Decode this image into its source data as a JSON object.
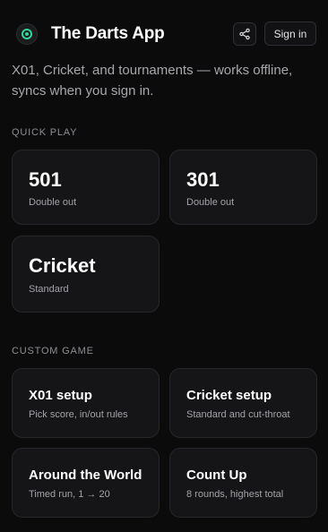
{
  "header": {
    "app_title": "The Darts App",
    "share_icon": "share-icon",
    "signin_label": "Sign in"
  },
  "tagline": "X01, Cricket, and tournaments — works offline, syncs when you sign in.",
  "quick_play": {
    "label": "QUICK PLAY",
    "cards": [
      {
        "title": "501",
        "subtitle": "Double out"
      },
      {
        "title": "301",
        "subtitle": "Double out"
      },
      {
        "title": "Cricket",
        "subtitle": "Standard"
      }
    ]
  },
  "custom_game": {
    "label": "CUSTOM GAME",
    "cards": [
      {
        "title": "X01 setup",
        "subtitle": "Pick score, in/out rules"
      },
      {
        "title": "Cricket setup",
        "subtitle": "Standard and cut-throat"
      },
      {
        "title": "Around the World",
        "subtitle": "Timed run, 1 → 20"
      },
      {
        "title": "Count Up",
        "subtitle": "8 rounds, highest total"
      }
    ]
  },
  "colors": {
    "background": "#0b0b0c",
    "card": "#151517",
    "accent": "#34d399"
  }
}
